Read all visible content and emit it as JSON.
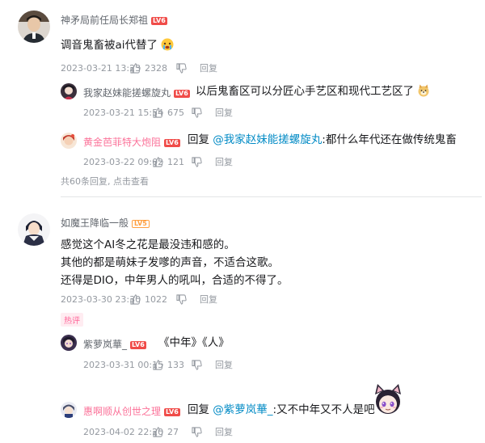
{
  "comments": [
    {
      "user": "神矛局前任局长郑祖",
      "level": "LV6",
      "text": "调音鬼畜被ai代替了",
      "emoji": "crying-emoji",
      "time": "2023-03-21 13:23",
      "likes": "2328",
      "reply_label": "回复",
      "replies": [
        {
          "user": "我家赵妹能搓螺旋丸",
          "level": "LV6",
          "text": "以后鬼畜区可以分匠心手艺区和现代工艺区了",
          "emoji": "doge-emoji",
          "time": "2023-03-21 15:54",
          "likes": "675",
          "reply_label": "回复"
        },
        {
          "user": "黄金芭菲特大炮阻",
          "level": "LV6",
          "reply_prefix": "回复",
          "mention": "@我家赵妹能搓螺旋丸",
          "text": ":都什么年代还在做传统鬼畜",
          "time": "2023-03-22 09:02",
          "likes": "121",
          "reply_label": "回复"
        }
      ],
      "summary": "共60条回复, 点击查看"
    },
    {
      "user": "如魔王降临一般",
      "level": "LV5",
      "lines": [
        "感觉这个AI冬之花是最没违和感的。",
        "其他的都是萌妹子发嗲的声音，不适合这歌。",
        "还得是DIO，中年男人的吼叫，合适的不得了。"
      ],
      "time": "2023-03-30 23:30",
      "likes": "1022",
      "reply_label": "回复",
      "tag": "热评",
      "replies": [
        {
          "user": "紫萝岚華_",
          "level": "LV6",
          "text": "《中年》《人》",
          "time": "2023-03-31 00:15",
          "likes": "133",
          "reply_label": "回复"
        },
        {
          "user": "惠啊顺从创世之理",
          "level": "LV6",
          "reply_prefix": "回复",
          "mention": "@紫萝岚華_",
          "text": ":又不中年又不人是吧",
          "emoji": "catgirl-sticker",
          "time": "2023-04-02 22:20",
          "likes": "27",
          "reply_label": "回复"
        }
      ]
    }
  ],
  "colors": {
    "username": "#61666d",
    "username_vip": "#fb7299",
    "mention": "#008ac5",
    "meta": "#9499a0",
    "hot_tag_bg": "#ffecf1",
    "hot_tag_fg": "#ff6699",
    "level_badge": "#f04c49"
  }
}
